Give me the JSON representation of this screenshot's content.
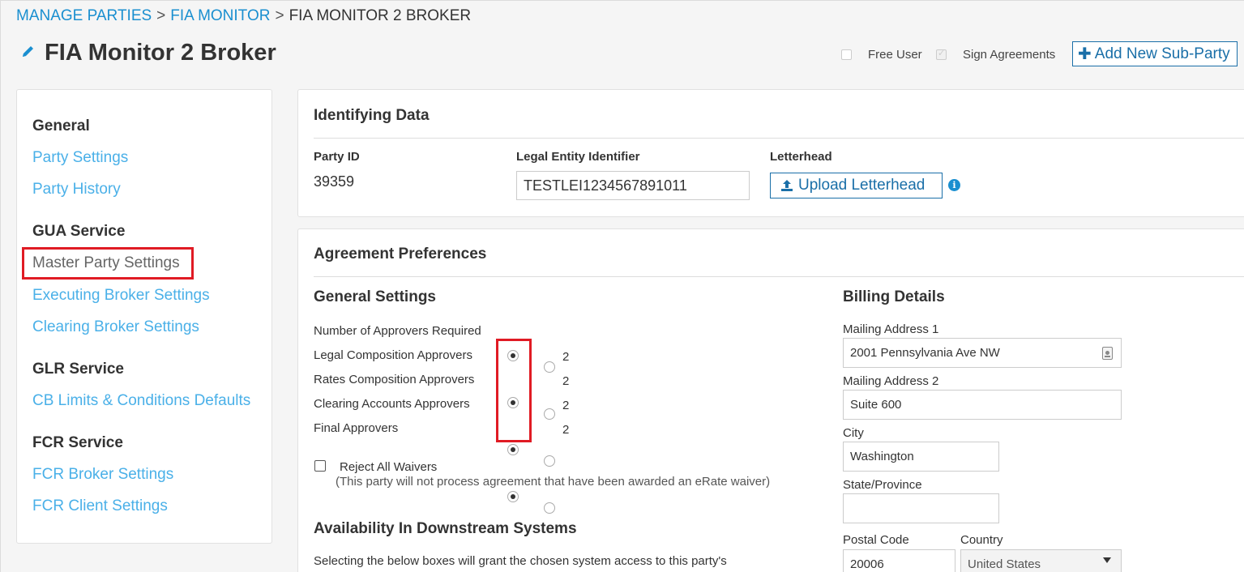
{
  "breadcrumb": {
    "item1": "MANAGE PARTIES",
    "item2": "FIA MONITOR",
    "item3": "FIA MONITOR 2 BROKER",
    "separator": ">"
  },
  "header": {
    "title": "FIA Monitor 2 Broker",
    "edit_icon": "pencil-icon",
    "free_user_label": "Free User",
    "sign_agreements_label": "Sign Agreements",
    "add_button_label": "Add New Sub-Party"
  },
  "sidebar": {
    "sections": [
      {
        "heading": "General",
        "items": [
          "Party Settings",
          "Party History"
        ]
      },
      {
        "heading": "GUA Service",
        "items": [
          "Master Party Settings",
          "Executing Broker Settings",
          "Clearing Broker Settings"
        ]
      },
      {
        "heading": "GLR Service",
        "items": [
          "CB Limits & Conditions Defaults"
        ]
      },
      {
        "heading": "FCR Service",
        "items": [
          "FCR Broker Settings",
          "FCR Client Settings"
        ]
      }
    ]
  },
  "identifying": {
    "title": "Identifying Data",
    "party_id_label": "Party ID",
    "party_id_value": "39359",
    "lei_label": "Legal Entity Identifier",
    "lei_value": "TESTLEI1234567891011",
    "letterhead_label": "Letterhead",
    "upload_label": "Upload Letterhead"
  },
  "agreement": {
    "title": "Agreement Preferences",
    "general_settings_title": "General Settings",
    "approvers_required_label": "Number of Approvers Required",
    "approver_rows": [
      {
        "label": "Legal Composition Approvers",
        "option2": "2",
        "selected": "1"
      },
      {
        "label": "Rates Composition Approvers",
        "option2": "2",
        "selected": "1"
      },
      {
        "label": "Clearing Accounts Approvers",
        "option2": "2",
        "selected": "1"
      },
      {
        "label": "Final Approvers",
        "option2": "2",
        "selected": "1"
      }
    ],
    "reject_waivers_label": "Reject All Waivers",
    "reject_waivers_note": "(This party will not process agreement that have been awarded an eRate waiver)",
    "downstream_title": "Availability In Downstream Systems",
    "downstream_text": "Selecting the below boxes will grant the chosen system access to this party's",
    "billing_title": "Billing Details",
    "mailing1_label": "Mailing Address 1",
    "mailing1_value": "2001 Pennsylvania Ave NW",
    "mailing2_label": "Mailing Address 2",
    "mailing2_value": "Suite 600",
    "city_label": "City",
    "city_value": "Washington",
    "state_label": "State/Province",
    "state_value": "",
    "postal_label": "Postal Code",
    "postal_value": "20006",
    "country_label": "Country",
    "country_value": "United States"
  },
  "colors": {
    "link": "#4ab0e8",
    "accent": "#1a6fa8",
    "highlight": "#e01b24"
  }
}
